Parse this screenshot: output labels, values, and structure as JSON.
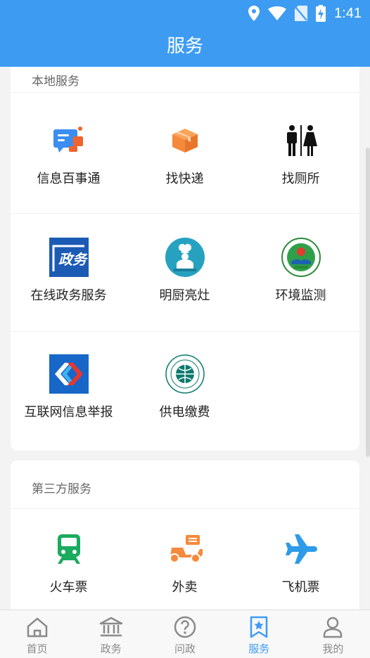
{
  "status_bar": {
    "time": "1:41",
    "icons": [
      "location-icon",
      "wifi-icon",
      "no-sim-icon",
      "battery-charging-icon"
    ]
  },
  "header": {
    "title": "服务"
  },
  "local_services": {
    "title": "本地服务",
    "items": [
      {
        "label": "信息百事通",
        "icon": "chat-bubbles-icon"
      },
      {
        "label": "找快递",
        "icon": "package-box-icon"
      },
      {
        "label": "找厕所",
        "icon": "restroom-icon"
      },
      {
        "label": "在线政务服务",
        "icon": "government-affairs-icon"
      },
      {
        "label": "明厨亮灶",
        "icon": "chef-icon"
      },
      {
        "label": "环境监测",
        "icon": "environment-emblem-icon"
      },
      {
        "label": "互联网信息举报",
        "icon": "internet-report-icon"
      },
      {
        "label": "供电缴费",
        "icon": "state-grid-logo-icon"
      }
    ]
  },
  "third_party_services": {
    "title": "第三方服务",
    "items": [
      {
        "label": "火车票",
        "icon": "train-icon"
      },
      {
        "label": "外卖",
        "icon": "scooter-delivery-icon"
      },
      {
        "label": "飞机票",
        "icon": "airplane-icon"
      }
    ]
  },
  "tabbar": {
    "active": "服务",
    "items": [
      {
        "label": "首页",
        "icon": "home-icon"
      },
      {
        "label": "政务",
        "icon": "government-building-icon"
      },
      {
        "label": "问政",
        "icon": "question-icon"
      },
      {
        "label": "服务",
        "icon": "bookmark-star-icon"
      },
      {
        "label": "我的",
        "icon": "user-icon"
      }
    ]
  },
  "colors": {
    "primary": "#3d9cf2",
    "background": "#f3f3f3",
    "inactive_tab": "#8a8a8a",
    "train_green": "#1aab5e",
    "delivery_orange": "#f58a3c"
  }
}
